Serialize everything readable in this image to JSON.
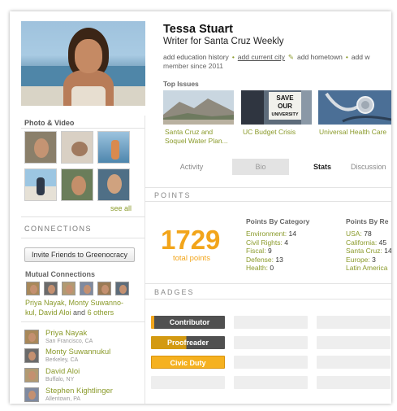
{
  "profile": {
    "name": "Tessa Stuart",
    "title": "Writer for Santa Cruz Weekly",
    "links": [
      "add education history",
      "add current city",
      "add hometown",
      "add w"
    ],
    "member_since": "member since 2011"
  },
  "photo_video": {
    "heading": "Photo & Video",
    "see_all": "see all"
  },
  "connections": {
    "heading": "CONNECTIONS",
    "invite_label": "Invite Friends to Greenocracy",
    "mutual_heading": "Mutual Connections",
    "mutual_names_1": "Priya Nayak, Monty Suwanno-",
    "mutual_names_2": "kul, David Aloi",
    "mutual_and": "and",
    "mutual_others": "6 others",
    "friends": [
      {
        "name": "Priya Nayak",
        "location": "San Francisco, CA"
      },
      {
        "name": "Monty Suwannukul",
        "location": "Berkeley, CA"
      },
      {
        "name": "David Aloi",
        "location": "Buffalo, NY"
      },
      {
        "name": "Stephen Kightlinger",
        "location": "Allentown, PA"
      }
    ]
  },
  "top_issues": {
    "heading": "Top Issues",
    "items": [
      {
        "caption_1": "Santa Cruz and",
        "caption_2": "Soquel Water Plan..."
      },
      {
        "caption_1": "UC Budget Crisis",
        "caption_2": ""
      },
      {
        "caption_1": "Universal Health Care",
        "caption_2": ""
      }
    ],
    "sign_text_1": "SAVE",
    "sign_text_2": "OUR",
    "sign_text_3": "UNIVERSITY"
  },
  "tabs": [
    "Activity",
    "Bio",
    "Stats",
    "Discussion"
  ],
  "points": {
    "heading": "POINTS",
    "total": "1729",
    "total_label": "total points",
    "by_category_heading": "Points By Category",
    "by_category": [
      {
        "label": "Environment:",
        "value": "14"
      },
      {
        "label": "Civil Rights:",
        "value": "4"
      },
      {
        "label": "Fiscal:",
        "value": "9"
      },
      {
        "label": "Defense:",
        "value": "13"
      },
      {
        "label": "Health:",
        "value": "0"
      }
    ],
    "by_region_heading": "Points By Re",
    "by_region": [
      {
        "label": "USA:",
        "value": "78"
      },
      {
        "label": "California:",
        "value": "45"
      },
      {
        "label": "Santa Cruz:",
        "value": "14"
      },
      {
        "label": "Europe:",
        "value": "3"
      },
      {
        "label": "Latin America",
        "value": ""
      }
    ]
  },
  "badges": {
    "heading": "BADGES",
    "items": [
      "Contributor",
      "Proofreader",
      "Civic Duty"
    ]
  },
  "colors": {
    "accent": "#f2a51b",
    "link": "#8a9a2a",
    "badge_dark": "#505050"
  }
}
